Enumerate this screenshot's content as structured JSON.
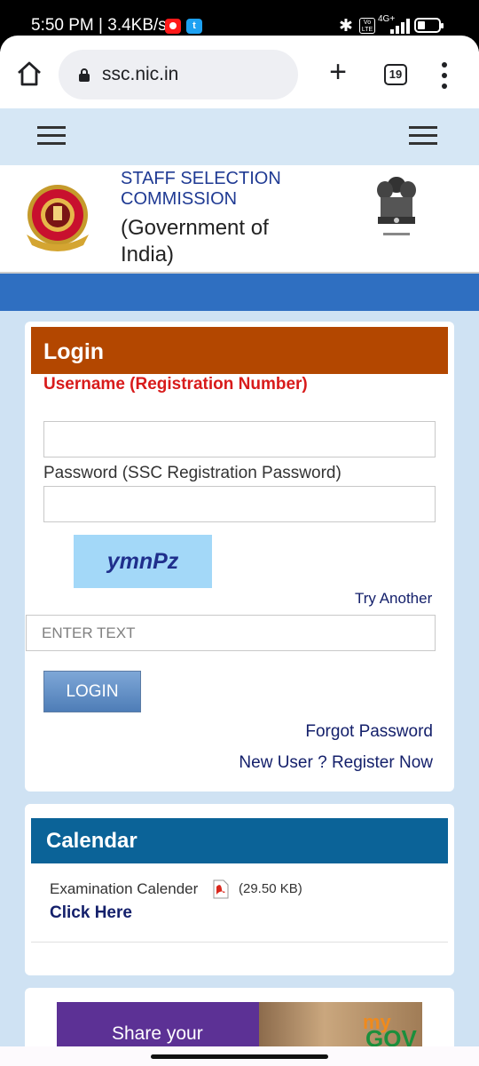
{
  "status_bar": {
    "time_speed": "5:50 PM | 3.4KB/s",
    "network": "4G+",
    "volte": "Vo LTE"
  },
  "browser": {
    "url": "ssc.nic.in",
    "tab_count": "19",
    "icons": [
      "home-icon",
      "lock-icon",
      "plus-icon",
      "tabs-icon",
      "more-vertical-icon"
    ]
  },
  "header": {
    "org_name_line1": "STAFF SELECTION",
    "org_name_line2": "COMMISSION",
    "org_sub_line1": "(Government of",
    "org_sub_line2": "India)"
  },
  "login": {
    "title": "Login",
    "username_label": "Username (Registration Number)",
    "username_value": "",
    "password_label": "Password (SSC Registration Password)",
    "password_value": "",
    "captcha_text": "ymnPz",
    "try_another": "Try Another",
    "captcha_placeholder": "ENTER TEXT",
    "login_button": "LOGIN",
    "forgot_password": "Forgot Password",
    "register": "New User ? Register Now"
  },
  "calendar": {
    "title": "Calendar",
    "item_label": "Examination Calender",
    "file_size": "(29.50 KB)",
    "link": "Click Here"
  },
  "banner": {
    "text": "Share your",
    "brand_my": "my",
    "brand_gov": "GOV"
  },
  "colors": {
    "login_header": "#b34700",
    "calendar_header": "#0b6398",
    "link": "#14206b",
    "username_label": "#d81b1b",
    "page_background": "#cfe2f3"
  }
}
